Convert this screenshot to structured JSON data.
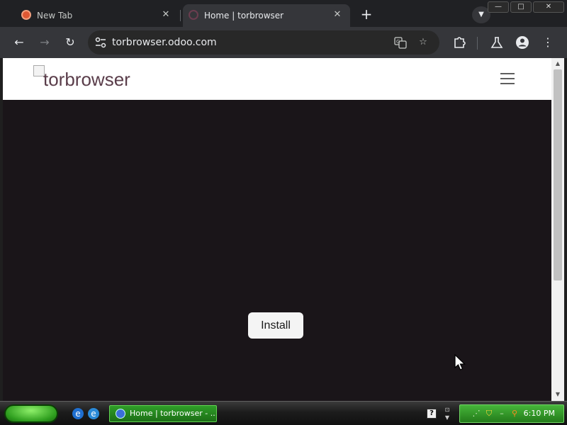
{
  "browser": {
    "tabs": [
      {
        "title": "New Tab",
        "active": false
      },
      {
        "title": "Home | torbrowser",
        "active": true
      }
    ],
    "url": "torbrowser.odoo.com",
    "colors": {
      "frame": "#202124",
      "toolbar": "#35363a",
      "omnibox": "#282828"
    }
  },
  "page": {
    "logo_alt": "torbrowser",
    "install_label": "Install",
    "colors": {
      "hero_bg": "#1a1519",
      "header_bg": "#ffffff"
    }
  },
  "taskbar": {
    "task_label": "Home | torbrowser - ...",
    "clock": "6:10 PM",
    "help_glyph": "?"
  },
  "window_controls": {
    "minimize": "—",
    "maximize": "□",
    "close": "✕"
  }
}
